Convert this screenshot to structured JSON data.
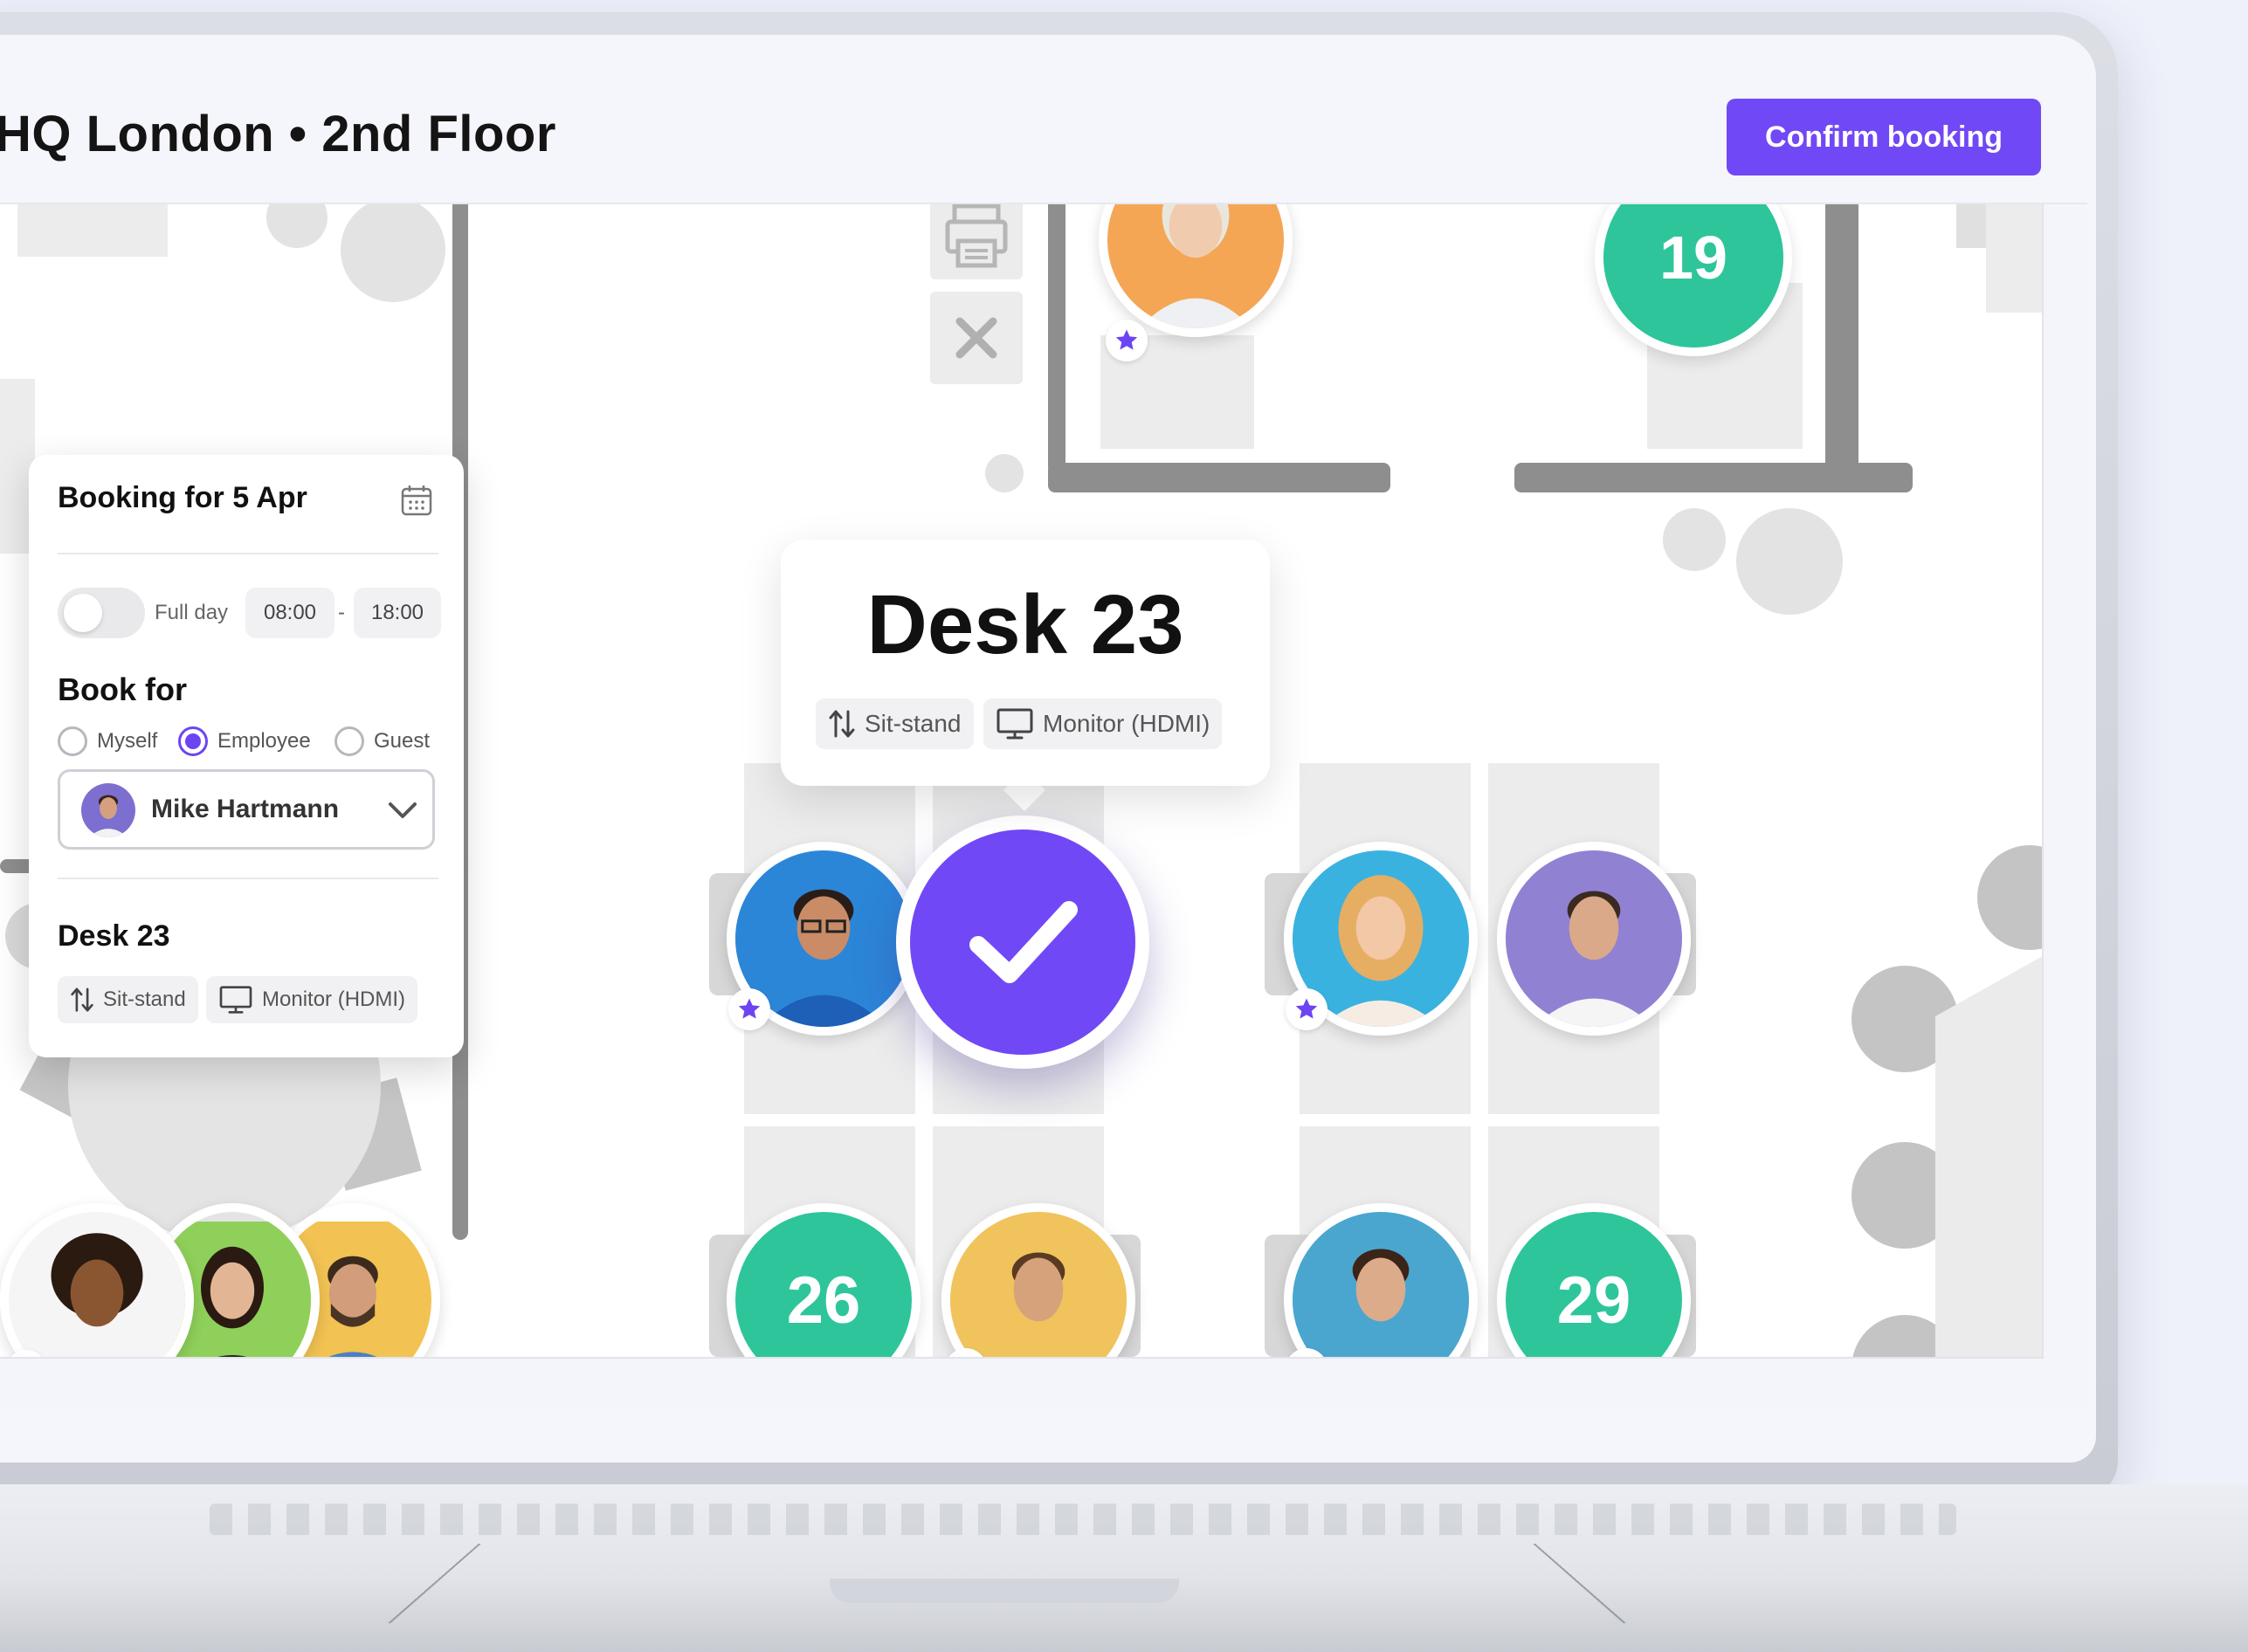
{
  "header": {
    "title": "HQ London • 2nd Floor",
    "confirm_label": "Confirm booking"
  },
  "booking_panel": {
    "title": "Booking for 5 Apr",
    "full_day_label": "Full day",
    "full_day_enabled": false,
    "start_time": "08:00",
    "time_separator": "-",
    "end_time": "18:00",
    "book_for_title": "Book for",
    "options": [
      "Myself",
      "Employee",
      "Guest"
    ],
    "selected_option": "Employee",
    "selected_person": "Mike Hartmann",
    "desk_title": "Desk 23",
    "features": [
      "Sit-stand",
      "Monitor (HDMI)"
    ]
  },
  "tooltip": {
    "title": "Desk 23",
    "features": [
      "Sit-stand",
      "Monitor (HDMI)"
    ]
  },
  "desks": {
    "available": [
      "19",
      "26",
      "29"
    ],
    "selected": "23"
  },
  "colors": {
    "accent": "#7148f5",
    "available": "#2ec59b",
    "star": "#6d44f2",
    "page_bg": "#eef0fa"
  },
  "icons": [
    "calendar-icon",
    "chevron-down-icon",
    "sit-stand-icon",
    "monitor-icon",
    "check-icon",
    "star-icon",
    "printer-icon",
    "close-icon"
  ]
}
